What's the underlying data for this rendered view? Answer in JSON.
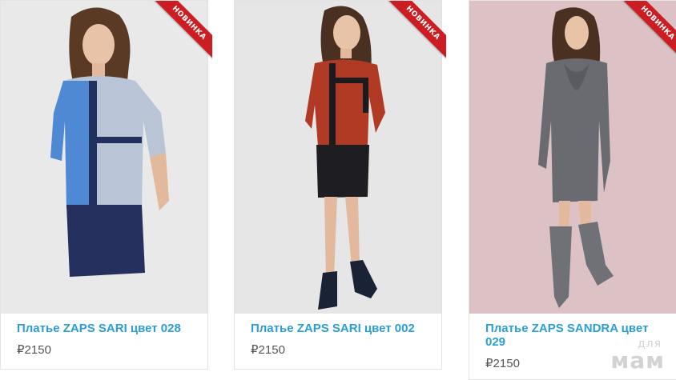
{
  "products": [
    {
      "badge": "НОВИНКА",
      "title": "Платье ZAPS SARI цвет 028",
      "price": "₽2150",
      "image": "model-in-blue-colorblock-dress"
    },
    {
      "badge": "НОВИНКА",
      "title": "Платье ZAPS SARI цвет 002",
      "price": "₽2150",
      "image": "model-in-red-black-colorblock-dress"
    },
    {
      "badge": "НОВИНКА",
      "title": "Платье ZAPS SANDRA цвет 029",
      "price": "₽2150",
      "image": "model-in-grey-dress-with-boots"
    }
  ],
  "watermark": {
    "line1": "для",
    "line2": "мам"
  },
  "colors": {
    "title_link": "#2a9fd6",
    "badge_bg": "#cc1d23",
    "price_text": "#555555"
  }
}
